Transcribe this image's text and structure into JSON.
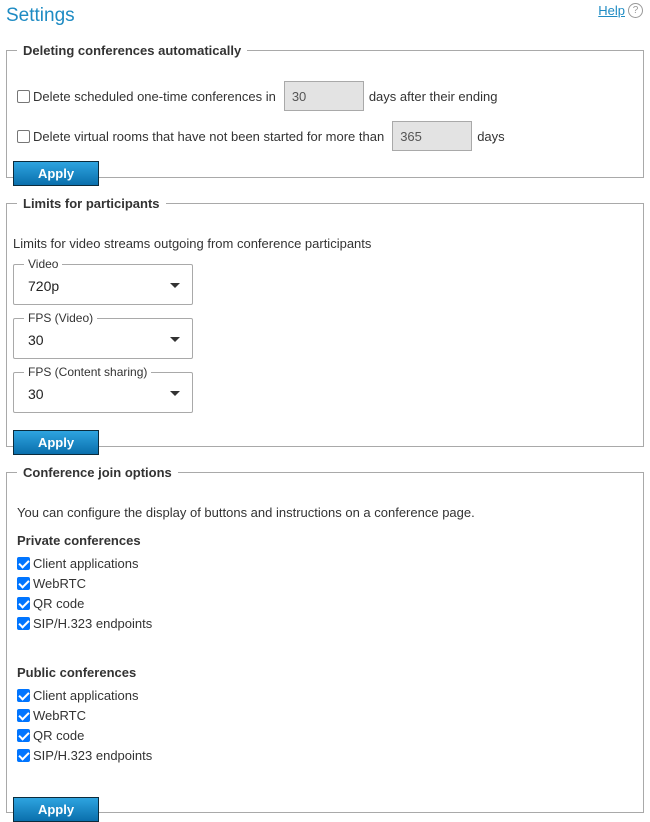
{
  "header": {
    "title": "Settings",
    "help_label": "Help",
    "help_icon": "question-circle-icon",
    "help_icon_glyph": "?"
  },
  "colors": {
    "accent": "#1e8bc3",
    "button_top": "#2ea4e0",
    "button_bottom": "#0a6fac",
    "checkbox_checked": "#0075ff"
  },
  "deleting": {
    "legend": "Deleting conferences automatically",
    "rows": [
      {
        "checked": false,
        "label": "Delete scheduled one-time conferences in",
        "value": "30",
        "suffix": "days after their ending"
      },
      {
        "checked": false,
        "label": "Delete virtual rooms that have not been started for more than",
        "value": "365",
        "suffix": "days"
      }
    ],
    "apply_label": "Apply"
  },
  "limits": {
    "legend": "Limits for participants",
    "description": "Limits for video streams outgoing from conference participants",
    "selects": [
      {
        "label": "Video",
        "value": "720p"
      },
      {
        "label": "FPS (Video)",
        "value": "30"
      },
      {
        "label": "FPS (Content sharing)",
        "value": "30"
      }
    ],
    "apply_label": "Apply"
  },
  "join": {
    "legend": "Conference join options",
    "description": "You can configure the display of buttons and instructions on a conference page.",
    "private": {
      "title": "Private conferences",
      "options": [
        {
          "label": "Client applications",
          "checked": true
        },
        {
          "label": "WebRTC",
          "checked": true
        },
        {
          "label": "QR code",
          "checked": true
        },
        {
          "label": "SIP/H.323 endpoints",
          "checked": true
        }
      ]
    },
    "public": {
      "title": "Public conferences",
      "options": [
        {
          "label": "Client applications",
          "checked": true
        },
        {
          "label": "WebRTC",
          "checked": true
        },
        {
          "label": "QR code",
          "checked": true
        },
        {
          "label": "SIP/H.323 endpoints",
          "checked": true
        }
      ]
    },
    "apply_label": "Apply"
  }
}
